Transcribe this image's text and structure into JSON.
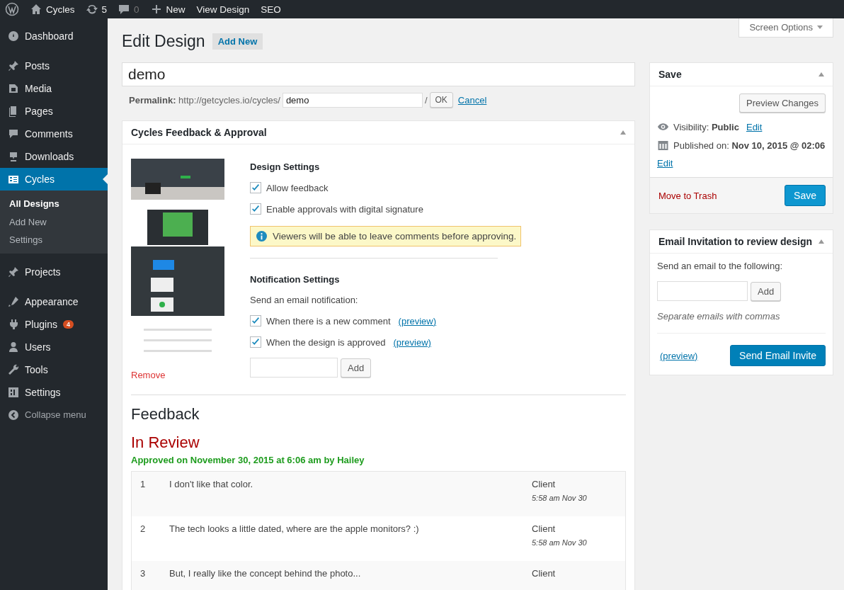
{
  "admin_bar": {
    "site": "Cycles",
    "updates": "5",
    "comments": "0",
    "new": "New",
    "links": [
      "View Design",
      "SEO"
    ]
  },
  "sidebar": {
    "items": [
      {
        "label": "Dashboard",
        "selected": false
      },
      {
        "label": "Posts",
        "selected": false
      },
      {
        "label": "Media",
        "selected": false
      },
      {
        "label": "Pages",
        "selected": false
      },
      {
        "label": "Comments",
        "selected": false
      },
      {
        "label": "Downloads",
        "selected": false
      },
      {
        "label": "Cycles",
        "selected": true,
        "children": [
          {
            "label": "All Designs",
            "selected": true
          },
          {
            "label": "Add New",
            "selected": false
          },
          {
            "label": "Settings",
            "selected": false
          }
        ]
      },
      {
        "label": "Projects",
        "selected": false
      },
      {
        "label": "Appearance",
        "selected": false
      },
      {
        "label": "Plugins",
        "selected": false,
        "badge": "4"
      },
      {
        "label": "Users",
        "selected": false
      },
      {
        "label": "Tools",
        "selected": false
      },
      {
        "label": "Settings",
        "selected": false
      }
    ],
    "collapse": "Collapse menu"
  },
  "screen_options": "Screen Options",
  "heading": "Edit Design",
  "add_new": "Add New",
  "title_field": {
    "value": "demo"
  },
  "permalink": {
    "label": "Permalink:",
    "base": "http://getcycles.io/cycles/",
    "slug": "demo",
    "separator": "/",
    "ok": "OK",
    "cancel": "Cancel"
  },
  "feedback_box": {
    "title": "Cycles Feedback & Approval",
    "remove": "Remove",
    "design_settings": {
      "title": "Design Settings",
      "options": [
        {
          "label": "Allow feedback",
          "checked": true
        },
        {
          "label": "Enable approvals with digital signature",
          "checked": true
        }
      ],
      "notice": "Viewers will be able to leave comments before approving."
    },
    "notification_settings": {
      "title": "Notification Settings",
      "intro": "Send an email notification:",
      "options": [
        {
          "label": "When there is a new comment",
          "link": "(preview)",
          "checked": true
        },
        {
          "label": "When the design is approved",
          "link": "(preview)",
          "checked": true
        }
      ],
      "add": "Add"
    },
    "feedback": {
      "title": "Feedback",
      "status": "In Review",
      "approved": "Approved on November 30, 2015 at 6:06 am by Hailey",
      "rows": [
        {
          "number": "1",
          "comment": "I don't like that color.",
          "author": "Client",
          "time": "5:58 am Nov 30"
        },
        {
          "number": "2",
          "comment": "The tech looks a little dated, where are the apple monitors? :)",
          "author": "Client",
          "time": "5:58 am Nov 30"
        },
        {
          "number": "3",
          "comment": "But, I really like the concept behind the photo...",
          "author": "Client"
        }
      ]
    }
  },
  "save_box": {
    "title": "Save",
    "preview": "Preview Changes",
    "visibility_label": "Visibility:",
    "visibility": "Public",
    "visibility_edit": "Edit",
    "published_label": "Published on:",
    "published": "Nov 10, 2015 @ 02:06",
    "published_edit": "Edit",
    "trash": "Move to Trash",
    "save": "Save"
  },
  "email_box": {
    "title": "Email Invitation to review design",
    "intro": "Send an email to the following:",
    "add": "Add",
    "hint": "Separate emails with commas",
    "preview": "(preview)",
    "send": "Send Email Invite"
  }
}
